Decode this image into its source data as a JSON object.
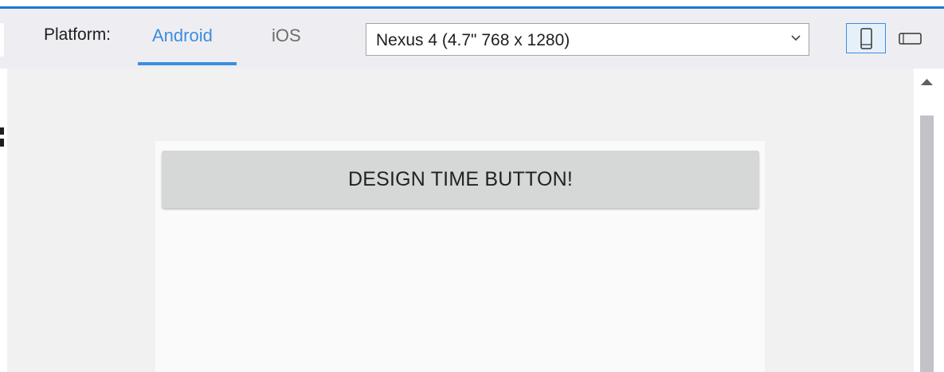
{
  "toolbar": {
    "platform_label": "Platform:",
    "tabs": [
      {
        "label": "Android",
        "selected": true
      },
      {
        "label": "iOS",
        "selected": false
      }
    ],
    "device_select": {
      "value": "Nexus 4 (4.7\" 768 x 1280)"
    },
    "orientation": {
      "selected": "portrait"
    }
  },
  "preview": {
    "button_label": "DESIGN TIME BUTTON!"
  },
  "colors": {
    "accent": "#3d8de0",
    "top_stripe": "#1e77cc",
    "toolbar_bg": "#eeeef2",
    "canvas_bg": "#f1f1f2",
    "button_bg": "#d6d7d7"
  },
  "icons": [
    "chevron-down-icon",
    "phone-portrait-icon",
    "phone-landscape-icon",
    "scroll-up-arrow-icon"
  ]
}
